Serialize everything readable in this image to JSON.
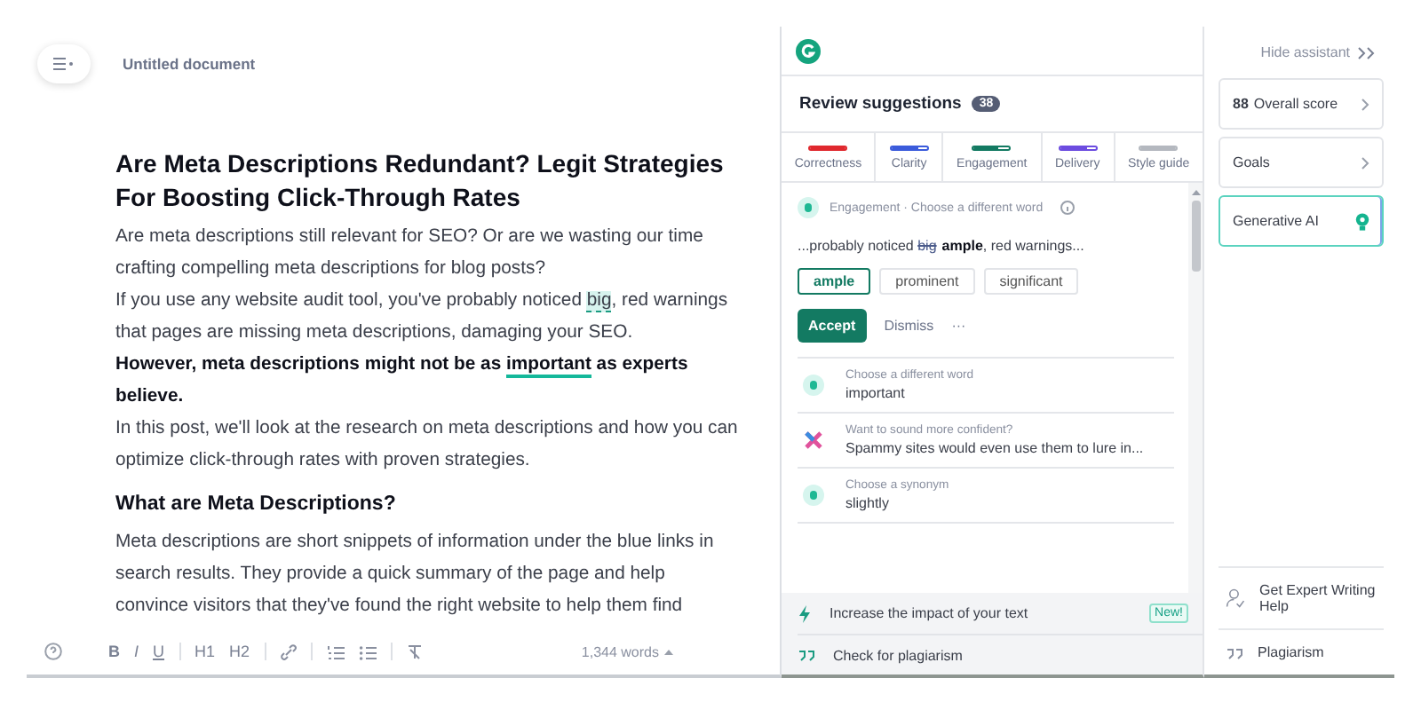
{
  "document": {
    "title": "Untitled document",
    "blocks": [
      {
        "kind": "heading",
        "parts": [
          {
            "text": "Are Meta Descriptions Redundant? Legit Strategies For Boosting Click-Through Rates"
          }
        ]
      },
      {
        "kind": "paragraph",
        "parts": [
          {
            "text": "Are meta descriptions still relevant for SEO? Or are we wasting our time crafting compelling meta descriptions for blog posts?"
          }
        ]
      },
      {
        "kind": "paragraph",
        "parts": [
          {
            "text": "If you use any website audit tool, you've probably noticed "
          },
          {
            "text": "big",
            "highlighted": true
          },
          {
            "text": ", red warnings that pages are missing meta descriptions, damaging your SEO."
          }
        ]
      },
      {
        "kind": "bold",
        "parts": [
          {
            "text": "However, meta descriptions might not be as "
          },
          {
            "text": "important",
            "underlined": true
          },
          {
            "text": " as experts believe."
          }
        ]
      },
      {
        "kind": "paragraph",
        "parts": [
          {
            "text": "In this post, we'll look at the research on meta descriptions and how you can optimize click-through rates with proven strategies."
          }
        ]
      },
      {
        "kind": "subheading",
        "parts": [
          {
            "text": "What are Meta Descriptions?"
          }
        ]
      },
      {
        "kind": "paragraph",
        "parts": [
          {
            "text": "Meta descriptions are short snippets of information under the blue links in search results. They provide a quick summary of the page and help convince visitors that they've found the right website to help them find"
          }
        ]
      }
    ],
    "toolbar": [
      {
        "kind": "help"
      },
      {
        "kind": "bold",
        "label": "B"
      },
      {
        "kind": "italic",
        "label": "I"
      },
      {
        "kind": "underline",
        "label": "U"
      },
      {
        "kind": "divider"
      },
      {
        "kind": "heading",
        "label": "H1"
      },
      {
        "kind": "heading",
        "label": "H2"
      },
      {
        "kind": "divider"
      },
      {
        "kind": "link"
      },
      {
        "kind": "divider"
      },
      {
        "kind": "numbered"
      },
      {
        "kind": "bulleted"
      },
      {
        "kind": "divider"
      },
      {
        "kind": "clear"
      }
    ],
    "word_count": "1,344 words"
  },
  "assistant": {
    "title": "Review suggestions",
    "count": "38",
    "categories": [
      {
        "label": "Correctness",
        "color": "#e0282e",
        "level": 1
      },
      {
        "label": "Clarity",
        "color": "#3b5bdb",
        "level": 0.75
      },
      {
        "label": "Engagement",
        "color": "#137a62",
        "level": 0.7
      },
      {
        "label": "Delivery",
        "color": "#6c4ce0",
        "level": 0.75
      },
      {
        "label": "Style guide",
        "color": "#b4b8bf",
        "level": 1
      }
    ],
    "active_card": {
      "category": "Engagement · Choose a different word",
      "preview": [
        {
          "text": "...probably noticed ",
          "kind": "plain"
        },
        {
          "text": "big",
          "kind": "removed"
        },
        {
          "text": "ample",
          "kind": "added"
        },
        {
          "text": ", red warnings...",
          "kind": "plain"
        }
      ],
      "options": [
        {
          "label": "ample",
          "selected": true
        },
        {
          "label": "prominent",
          "selected": false
        },
        {
          "label": "significant",
          "selected": false
        }
      ],
      "accept": "Accept",
      "dismiss": "Dismiss",
      "more": "···"
    },
    "suggestions": [
      {
        "kind": "engagement",
        "title": "Choose a different word",
        "text": "important"
      },
      {
        "kind": "confidence",
        "title": "Want to sound more confident?",
        "text": "Spammy sites would even use them to lure in..."
      },
      {
        "kind": "engagement",
        "title": "Choose a synonym",
        "text": "slightly"
      }
    ],
    "features": [
      {
        "kind": "impact",
        "label": "Increase the impact of your text",
        "badge": "New!"
      },
      {
        "kind": "plagiarism",
        "label": "Check for plagiarism"
      }
    ]
  },
  "rail": {
    "hide": "Hide assistant",
    "cards": [
      {
        "kind": "score",
        "score": "88",
        "label": "Overall score",
        "selected": false
      },
      {
        "kind": "goals",
        "label": "Goals",
        "selected": false
      },
      {
        "kind": "ai",
        "label": "Generative AI",
        "selected": true
      }
    ],
    "bottom": [
      {
        "kind": "expert",
        "label": "Get Expert Writing Help"
      },
      {
        "kind": "plagiarism",
        "label": "Plagiarism"
      }
    ]
  }
}
